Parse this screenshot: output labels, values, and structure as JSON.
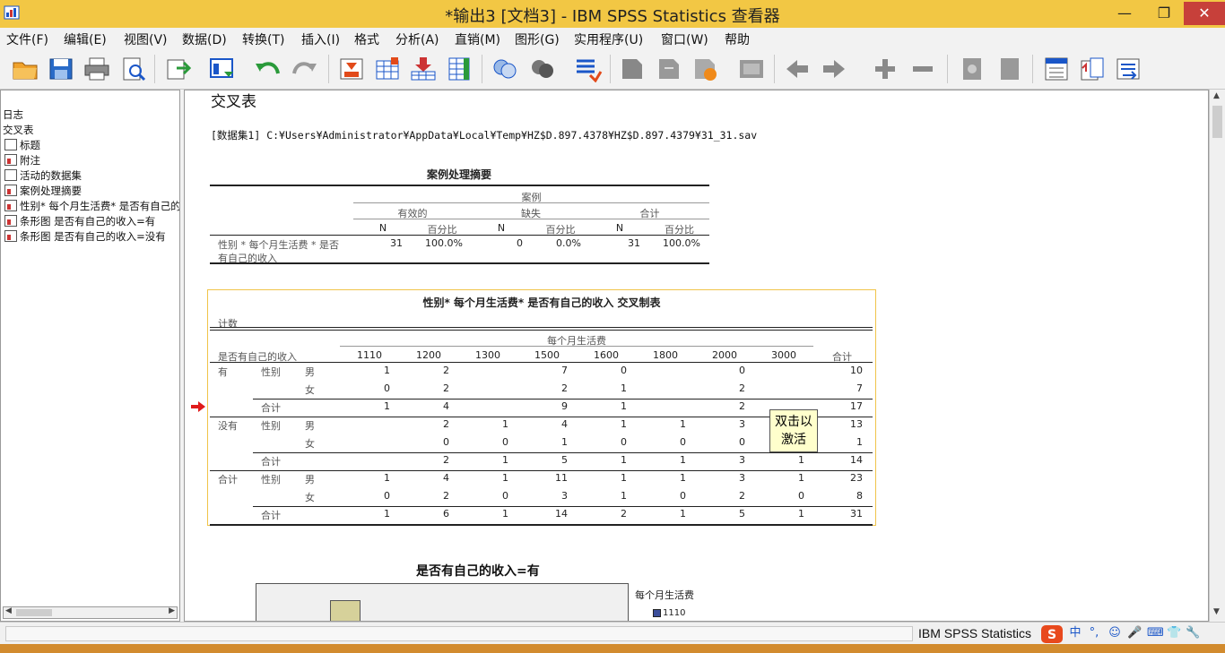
{
  "window": {
    "title": "*输出3 [文档3] - IBM SPSS Statistics 查看器",
    "minimize": "—",
    "maximize": "❐",
    "close": "✕"
  },
  "menu": [
    "文件(F)",
    "编辑(E)",
    "视图(V)",
    "数据(D)",
    "转换(T)",
    "插入(I)",
    "格式",
    "分析(A)",
    "直销(M)",
    "图形(G)",
    "实用程序(U)",
    "窗口(W)",
    "帮助"
  ],
  "toolbar_icons": [
    "open-icon",
    "save-icon",
    "print-icon",
    "print-preview-icon",
    "export-icon",
    "recall-dialog-icon",
    "undo-icon",
    "redo-icon",
    "goto-case-icon",
    "goto-variable-icon",
    "insert-cases-icon",
    "variables-icon",
    "split-file-icon",
    "weight-cases-icon",
    "select-cases-icon",
    "value-labels-icon",
    "use-sets-icon",
    "show-all-icon",
    "spelling-icon",
    "designate-window-icon",
    "back-icon",
    "forward-icon",
    "expand-icon",
    "collapse-icon",
    "show-icon",
    "hide-icon",
    "insert-heading-icon",
    "insert-title-icon",
    "insert-text-icon"
  ],
  "nav": {
    "items": [
      "日志",
      "交叉表",
      "标题",
      "附注",
      "活动的数据集",
      "案例处理摘要",
      "性别* 每个月生活费* 是否有自己的收入",
      "条形图 是否有自己的收入=有",
      "条形图 是否有自己的收入=没有"
    ]
  },
  "content": {
    "section_title": "交叉表",
    "dataset_line": "[数据集1] C:¥Users¥Administrator¥AppData¥Local¥Temp¥HZ$D.897.4378¥HZ$D.897.4379¥31_31.sav",
    "summary": {
      "title": "案例处理摘要",
      "group_header": "案例",
      "groups": [
        "有效的",
        "缺失",
        "合计"
      ],
      "sub_headers": [
        "N",
        "百分比",
        "N",
        "百分比",
        "N",
        "百分比"
      ],
      "row_label_1": "性别 * 每个月生活费 * 是否",
      "row_label_2": "有自己的收入",
      "values": [
        "31",
        "100.0%",
        "0",
        "0.0%",
        "31",
        "100.0%"
      ]
    },
    "crosstab": {
      "title": "性别* 每个月生活费* 是否有自己的收入 交叉制表",
      "count_label": "计数",
      "col_group": "每个月生活费",
      "layer_header": "是否有自己的收入",
      "columns": [
        "1110",
        "1200",
        "1300",
        "1500",
        "1600",
        "1800",
        "2000",
        "3000"
      ],
      "total_header": "合计",
      "rows": [
        {
          "layer": "有",
          "var": "性别",
          "cat": "男",
          "cells": [
            "1",
            "2",
            "",
            "7",
            "0",
            "",
            "0",
            ""
          ],
          "total": "10"
        },
        {
          "layer": "",
          "var": "",
          "cat": "女",
          "cells": [
            "0",
            "2",
            "",
            "2",
            "1",
            "",
            "2",
            ""
          ],
          "total": "7"
        },
        {
          "layer": "",
          "var": "合计",
          "cat": "",
          "cells": [
            "1",
            "4",
            "",
            "9",
            "1",
            "",
            "2",
            ""
          ],
          "total": "17"
        },
        {
          "layer": "没有",
          "var": "性别",
          "cat": "男",
          "cells": [
            "",
            "2",
            "1",
            "4",
            "1",
            "1",
            "3",
            ""
          ],
          "total": "13"
        },
        {
          "layer": "",
          "var": "",
          "cat": "女",
          "cells": [
            "",
            "0",
            "0",
            "1",
            "0",
            "0",
            "0",
            ""
          ],
          "total": "1"
        },
        {
          "layer": "",
          "var": "合计",
          "cat": "",
          "cells": [
            "",
            "2",
            "1",
            "5",
            "1",
            "1",
            "3",
            "1"
          ],
          "total": "14"
        },
        {
          "layer": "合计",
          "var": "性别",
          "cat": "男",
          "cells": [
            "1",
            "4",
            "1",
            "11",
            "1",
            "1",
            "3",
            "1"
          ],
          "total": "23"
        },
        {
          "layer": "",
          "var": "",
          "cat": "女",
          "cells": [
            "0",
            "2",
            "0",
            "3",
            "1",
            "0",
            "2",
            "0"
          ],
          "total": "8"
        },
        {
          "layer": "",
          "var": "合计",
          "cat": "",
          "cells": [
            "1",
            "6",
            "1",
            "14",
            "2",
            "1",
            "5",
            "1"
          ],
          "total": "31"
        }
      ],
      "tooltip_line1": "双击以",
      "tooltip_line2": "激活"
    },
    "chart": {
      "title": "是否有自己的收入=有",
      "legend_title": "每个月生活费",
      "legend_item": "1110",
      "legend_color": "#3b4e9a",
      "bar_color": "#d6d19a"
    }
  },
  "statusbar": {
    "processor": "IBM SPSS Statistics",
    "tray": [
      "中",
      "°,",
      "☺",
      "🎤",
      "⌨",
      "👕",
      "🔧"
    ]
  }
}
